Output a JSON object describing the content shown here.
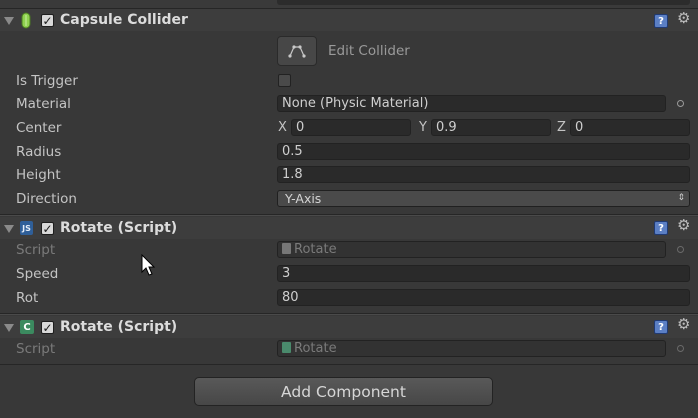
{
  "capsule": {
    "title": "Capsule Collider",
    "enabled": true,
    "edit_label": "Edit Collider",
    "rows": {
      "is_trigger": {
        "label": "Is Trigger",
        "checked": false
      },
      "material": {
        "label": "Material",
        "value": "None (Physic Material)"
      },
      "center": {
        "label": "Center",
        "x_label": "X",
        "x": "0",
        "y_label": "Y",
        "y": "0.9",
        "z_label": "Z",
        "z": "0"
      },
      "radius": {
        "label": "Radius",
        "value": "0.5"
      },
      "height": {
        "label": "Height",
        "value": "1.8"
      },
      "direction": {
        "label": "Direction",
        "value": "Y-Axis"
      }
    }
  },
  "rotate_js": {
    "title": "Rotate (Script)",
    "enabled": true,
    "icon": "JS",
    "script_label": "Script",
    "script_value": "Rotate",
    "speed_label": "Speed",
    "speed_value": "3",
    "rot_label": "Rot",
    "rot_value": "80"
  },
  "rotate_cs": {
    "title": "Rotate (Script)",
    "enabled": true,
    "icon": "C",
    "script_label": "Script",
    "script_value": "Rotate"
  },
  "add_component": "Add Component",
  "colors": {
    "help": "#5b7fc4",
    "collider_icon": "#8fd14f"
  },
  "icons": {
    "foldout": "foldout-arrow-icon",
    "help": "help-book-icon",
    "settings": "gear-icon",
    "collider": "capsule-collider-icon",
    "object_picker": "object-picker-icon",
    "cursor": "mouse-cursor-icon"
  }
}
